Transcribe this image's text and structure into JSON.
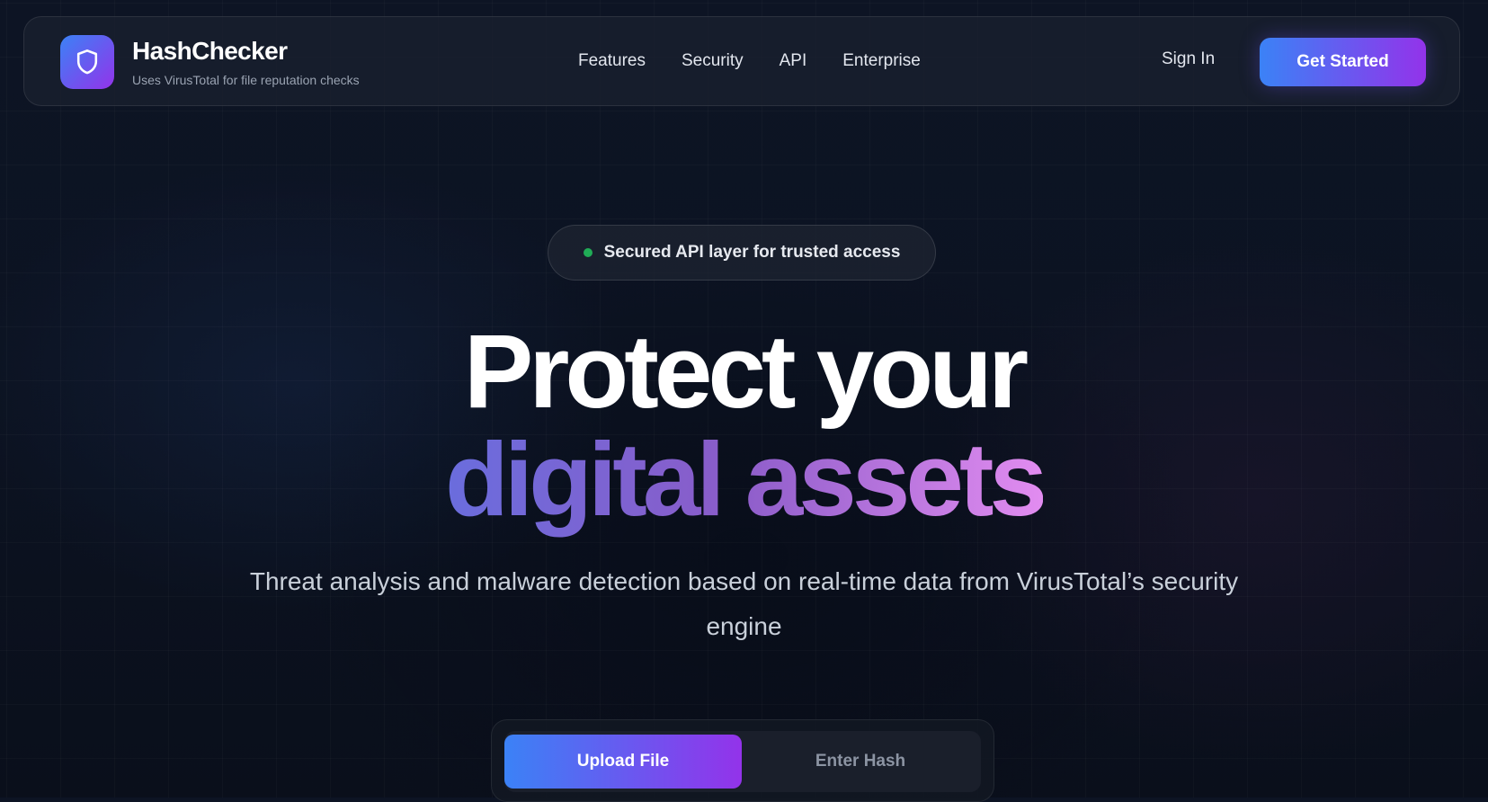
{
  "header": {
    "brand_name": "HashChecker",
    "brand_tagline": "Uses VirusTotal for file reputation checks",
    "logo_icon": "shield-icon",
    "nav_links": [
      {
        "label": "Features"
      },
      {
        "label": "Security"
      },
      {
        "label": "API"
      },
      {
        "label": "Enterprise"
      }
    ],
    "sign_in_label": "Sign In",
    "cta_label": "Get Started"
  },
  "hero": {
    "badge_text": "Secured API layer for trusted access",
    "headline_line1": "Protect your",
    "headline_line2": "digital assets",
    "subtitle": "Threat analysis and malware detection based on real-time data from VirusTotal’s security engine"
  },
  "input_toggle": {
    "tabs": [
      {
        "label": "Upload File",
        "active": true
      },
      {
        "label": "Enter Hash",
        "active": false
      }
    ]
  },
  "colors": {
    "accent_start": "#3b82f6",
    "accent_end": "#9333ea",
    "status_green": "#22c55e",
    "background": "#0c1322"
  }
}
